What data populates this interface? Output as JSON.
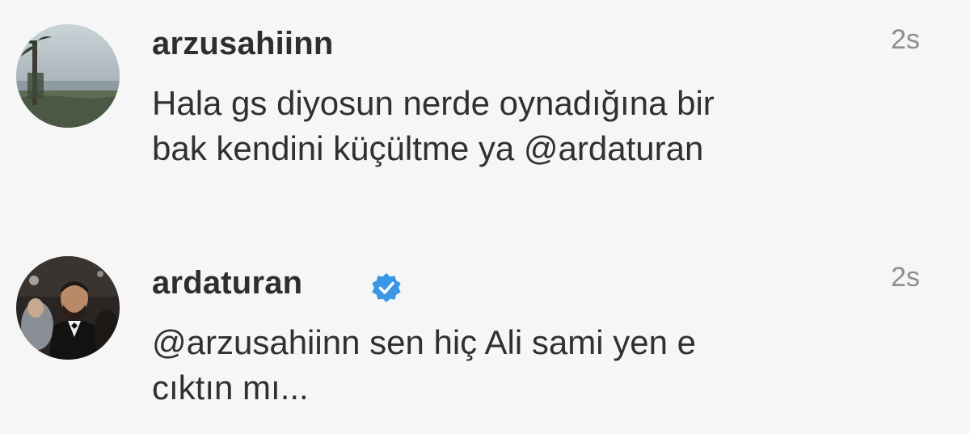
{
  "comments": [
    {
      "username": "arzusahiinn",
      "time": "2s",
      "text_line1": "Hala gs diyosun nerde oynadığına bir",
      "text_line2": "bak kendini küçültme ya @ardaturan",
      "avatar_icon": "profile-photo-landscape",
      "verified": false
    },
    {
      "username": "ardaturan",
      "time": "2s",
      "text_line1": "@arzusahiinn sen hiç Ali sami yen e",
      "text_line2": "cıktın mı...",
      "avatar_icon": "profile-photo-person",
      "verified": true,
      "verified_icon": "verified-badge-icon",
      "verified_color": "#3a97e8"
    }
  ],
  "colors": {
    "background": "#f5f6f5",
    "username": "#2e2e2e",
    "text": "#303030",
    "timestamp": "#8e8e8e",
    "verified": "#3a97e8"
  }
}
